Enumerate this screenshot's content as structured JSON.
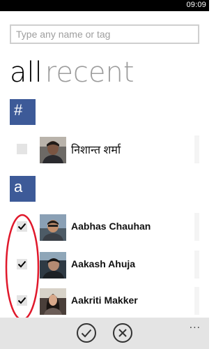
{
  "status_bar": {
    "time": "09:09"
  },
  "search": {
    "placeholder": "Type any name or tag",
    "value": ""
  },
  "pivot": {
    "active": "all",
    "inactive": "recent"
  },
  "groups": [
    {
      "letter": "#",
      "contacts": [
        {
          "name": "निशान्त शर्मा",
          "checked": false
        }
      ]
    },
    {
      "letter": "a",
      "contacts": [
        {
          "name": "Aabhas Chauhan",
          "checked": true
        },
        {
          "name": "Aakash Ahuja",
          "checked": true
        },
        {
          "name": "Aakriti Makker",
          "checked": true
        }
      ]
    }
  ],
  "app_bar": {
    "buttons": [
      {
        "icon": "check-icon"
      },
      {
        "icon": "cancel-icon"
      }
    ],
    "more": "..."
  },
  "colors": {
    "accent": "#3d5a98",
    "annotation": "#e0182b",
    "app_bar": "#e4e4e4"
  }
}
